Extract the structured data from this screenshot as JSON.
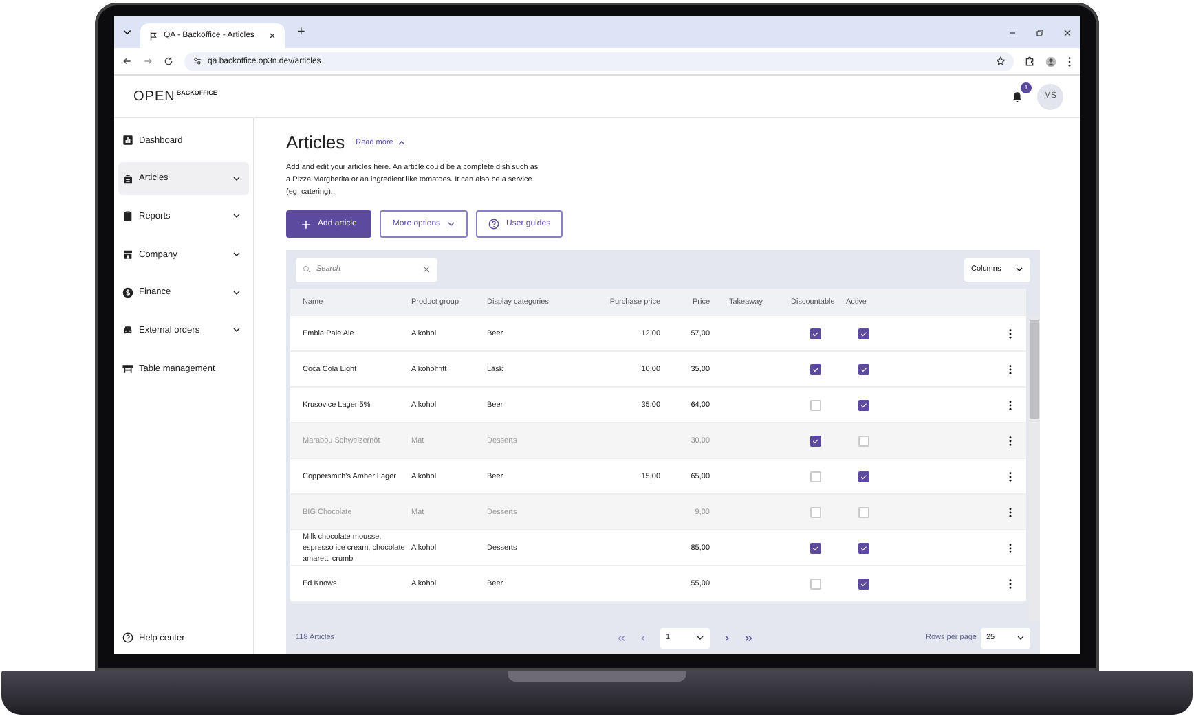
{
  "browser": {
    "tab_title": "QA - Backoffice - Articles",
    "new_tab": "+",
    "url": "qa.backoffice.op3n.dev/articles"
  },
  "header": {
    "logo": "OPEN",
    "logo_suffix": "BACKOFFICE",
    "notifications": "1",
    "avatar": "MS"
  },
  "sidebar": {
    "items": [
      {
        "label": "Dashboard",
        "selected": false,
        "expandable": false
      },
      {
        "label": "Articles",
        "selected": true,
        "expandable": true
      },
      {
        "label": "Reports",
        "selected": false,
        "expandable": true
      },
      {
        "label": "Company",
        "selected": false,
        "expandable": true
      },
      {
        "label": "Finance",
        "selected": false,
        "expandable": true
      },
      {
        "label": "External orders",
        "selected": false,
        "expandable": true
      },
      {
        "label": "Table management",
        "selected": false,
        "expandable": false
      }
    ],
    "help": "Help center"
  },
  "page": {
    "title": "Articles",
    "read_more": "Read more",
    "description": "Add and edit your articles here. An article could be a complete dish such as a Pizza Margherita or an ingredient like tomatoes. It can also be a service (eg. catering).",
    "buttons": [
      {
        "label": "Add article",
        "kind": "primary"
      },
      {
        "label": "More options",
        "kind": "dropdown"
      },
      {
        "label": "User guides",
        "kind": "help"
      }
    ]
  },
  "table": {
    "search": {
      "placeholder": "Search"
    },
    "columns_button": "Columns",
    "columns": [
      "Name",
      "Product group",
      "Display categories",
      "Purchase price",
      "Price",
      "Takeaway",
      "Discountable",
      "Active"
    ],
    "rows": [
      {
        "name": "Embla Pale Ale",
        "product_group": "Alkohol",
        "display_category": "Beer",
        "purchase_price": "12,00",
        "price": "57,00",
        "discountable": true,
        "active": true
      },
      {
        "name": "Coca Cola Light",
        "product_group": "Alkoholfritt",
        "display_category": "Läsk",
        "purchase_price": "10,00",
        "price": "35,00",
        "discountable": true,
        "active": true
      },
      {
        "name": "Krusovice Lager 5%",
        "product_group": "Alkohol",
        "display_category": "Beer",
        "purchase_price": "35,00",
        "price": "64,00",
        "discountable": false,
        "active": true
      },
      {
        "name": "Marabou Schweizernöt",
        "product_group": "Mat",
        "display_category": "Desserts",
        "purchase_price": "",
        "price": "30,00",
        "discountable": true,
        "active": false
      },
      {
        "name": "Coppersmith's Amber Lager",
        "product_group": "Alkohol",
        "display_category": "Beer",
        "purchase_price": "15,00",
        "price": "65,00",
        "discountable": false,
        "active": true
      },
      {
        "name": "BIG Chocolate",
        "product_group": "Mat",
        "display_category": "Desserts",
        "purchase_price": "",
        "price": "9,00",
        "discountable": false,
        "active": false
      },
      {
        "name": "Milk chocolate mousse, espresso ice cream, chocolate amaretti crumb",
        "product_group": "Alkohol",
        "display_category": "Desserts",
        "purchase_price": "",
        "price": "85,00",
        "discountable": true,
        "active": true
      },
      {
        "name": "Ed Knows",
        "product_group": "Alkohol",
        "display_category": "Beer",
        "purchase_price": "",
        "price": "55,00",
        "discountable": false,
        "active": true
      }
    ],
    "footer": {
      "count": "118 Articles",
      "page": "1",
      "rows_per_page_label": "Rows per page",
      "rows_per_page": "25"
    }
  }
}
